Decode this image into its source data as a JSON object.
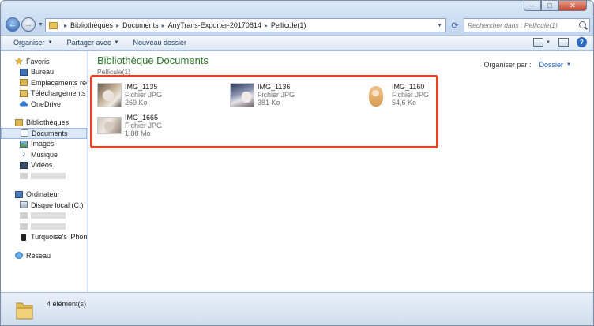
{
  "address": {
    "crumbs": [
      "Bibliothèques",
      "Documents",
      "AnyTrans-Exporter-20170814",
      "Pellicule(1)"
    ]
  },
  "search": {
    "placeholder": "Rechercher dans : Pellicule(1)"
  },
  "toolbar": {
    "organize": "Organiser",
    "share": "Partager avec",
    "new_folder": "Nouveau dossier"
  },
  "sidebar": {
    "favorites": {
      "label": "Favoris",
      "items": [
        "Bureau",
        "Emplacements récents",
        "Téléchargements",
        "OneDrive"
      ]
    },
    "libraries": {
      "label": "Bibliothèques",
      "items": [
        "Documents",
        "Images",
        "Musique",
        "Vidéos"
      ]
    },
    "computer": {
      "label": "Ordinateur",
      "items": [
        "Disque local (C:)",
        "Turquoise's iPhone"
      ]
    },
    "network": {
      "label": "Réseau"
    }
  },
  "content": {
    "title": "Bibliothèque Documents",
    "subtitle": "Pellicule(1)",
    "arrange_label": "Organiser par :",
    "arrange_value": "Dossier",
    "files": [
      {
        "name": "IMG_1135",
        "type": "Fichier JPG",
        "size": "269 Ko"
      },
      {
        "name": "IMG_1136",
        "type": "Fichier JPG",
        "size": "381 Ko"
      },
      {
        "name": "IMG_1160",
        "type": "Fichier JPG",
        "size": "54,6 Ko"
      },
      {
        "name": "IMG_1665",
        "type": "Fichier JPG",
        "size": "1,88 Mo"
      }
    ]
  },
  "status": {
    "count": "4 élément(s)"
  },
  "colors": {
    "highlight": "#e8432a",
    "library_title": "#2a7a2a",
    "link": "#1e5bb5"
  }
}
